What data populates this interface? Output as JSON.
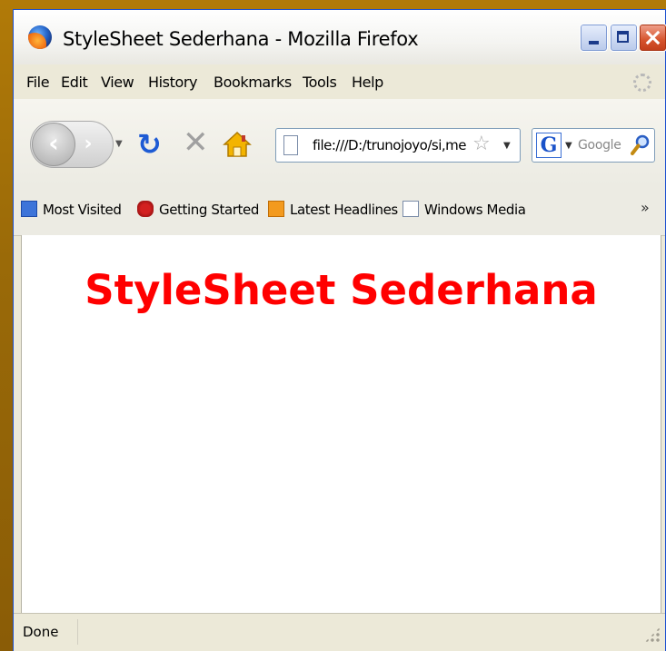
{
  "window": {
    "title": "StyleSheet Sederhana - Mozilla Firefox",
    "title_icon": "firefox-icon",
    "controls": [
      "minimize-icon",
      "maximize-icon",
      "close-icon"
    ]
  },
  "menu": {
    "items": [
      {
        "label": "File"
      },
      {
        "label": "Edit"
      },
      {
        "label": "View"
      },
      {
        "label": "History"
      },
      {
        "label": "Bookmarks"
      },
      {
        "label": "Tools"
      },
      {
        "label": "Help"
      }
    ]
  },
  "navigation": {
    "back_icon": "back-arrow-icon",
    "forward_icon": "forward-arrow-icon",
    "reload_icon": "reload-icon",
    "stop_icon": "stop-icon",
    "home_icon": "home-icon",
    "url": "file:///D:/trunojoyo/si,me",
    "bookmark_star_icon": "star-icon",
    "search": {
      "engine_icon": "google-g-icon",
      "placeholder": "Google"
    }
  },
  "bookmarks_bar": {
    "items": [
      {
        "label": "Most Visited",
        "icon": "most-visited-icon"
      },
      {
        "label": "Getting Started",
        "icon": "getting-started-icon"
      },
      {
        "label": "Latest Headlines",
        "icon": "rss-feed-icon"
      },
      {
        "label": "Windows Media",
        "icon": "page-icon"
      }
    ],
    "overflow": "»"
  },
  "page": {
    "heading": "StyleSheet Sederhana",
    "heading_color": "#ff0000"
  },
  "status": {
    "text": "Done"
  },
  "colors": {
    "background": "#9a6a08",
    "window_border": "#1b4fd0",
    "chrome": "#ece9d8"
  }
}
